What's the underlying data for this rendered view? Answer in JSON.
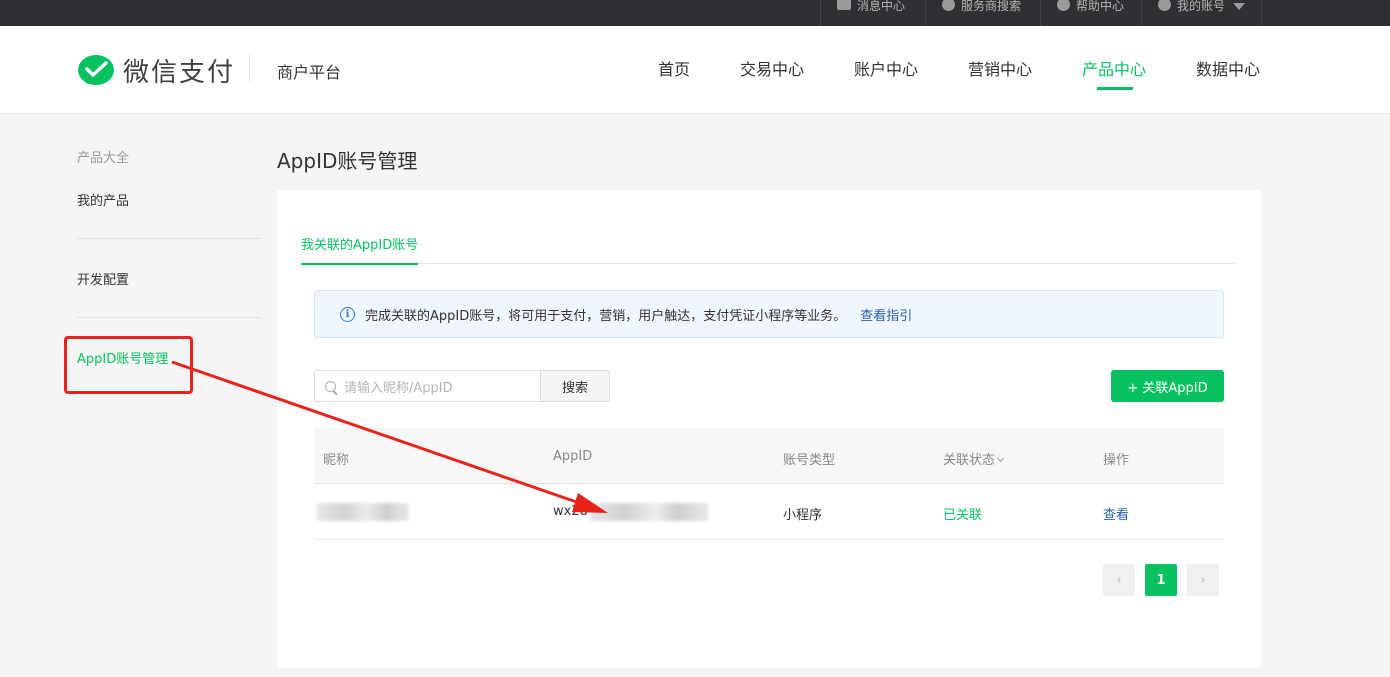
{
  "topbar": {
    "items": [
      {
        "label": "消息中心",
        "icon": "mail-icon"
      },
      {
        "label": "服务商搜索",
        "icon": "search-icon"
      },
      {
        "label": "帮助中心",
        "icon": "help-icon"
      },
      {
        "label": "我的账号",
        "icon": "user-icon"
      }
    ]
  },
  "header": {
    "logo_text": "微信支付",
    "platform": "商户平台",
    "nav": [
      {
        "label": "首页"
      },
      {
        "label": "交易中心"
      },
      {
        "label": "账户中心"
      },
      {
        "label": "营销中心"
      },
      {
        "label": "产品中心",
        "active": true
      },
      {
        "label": "数据中心"
      }
    ]
  },
  "sidebar": {
    "title": "产品大全",
    "items": [
      {
        "label": "我的产品"
      },
      {
        "label": "开发配置"
      },
      {
        "label": "AppID账号管理",
        "active": true
      }
    ]
  },
  "main": {
    "page_title": "AppID账号管理",
    "tab": "我关联的AppID账号",
    "notice": {
      "text": "完成关联的AppID账号，将可用于支付，营销，用户触达，支付凭证小程序等业务。",
      "link": "查看指引"
    },
    "search": {
      "placeholder": "请输入昵称/AppID",
      "button": "搜索"
    },
    "add_button": "+ 关联AppID",
    "table": {
      "headers": [
        "昵称",
        "AppID",
        "账号类型",
        "关联状态",
        "操作"
      ],
      "rows": [
        {
          "nickname": "",
          "appid_prefix": "wx28",
          "type": "小程序",
          "status": "已关联",
          "action": "查看"
        }
      ]
    },
    "pagination": {
      "current": "1",
      "prev_icon": "chevron-left-icon",
      "next_icon": "chevron-right-icon"
    }
  },
  "colors": {
    "accent": "#07c160",
    "link": "#2b5ea8",
    "annotation": "#e8231b",
    "topbar": "#2f3033"
  }
}
